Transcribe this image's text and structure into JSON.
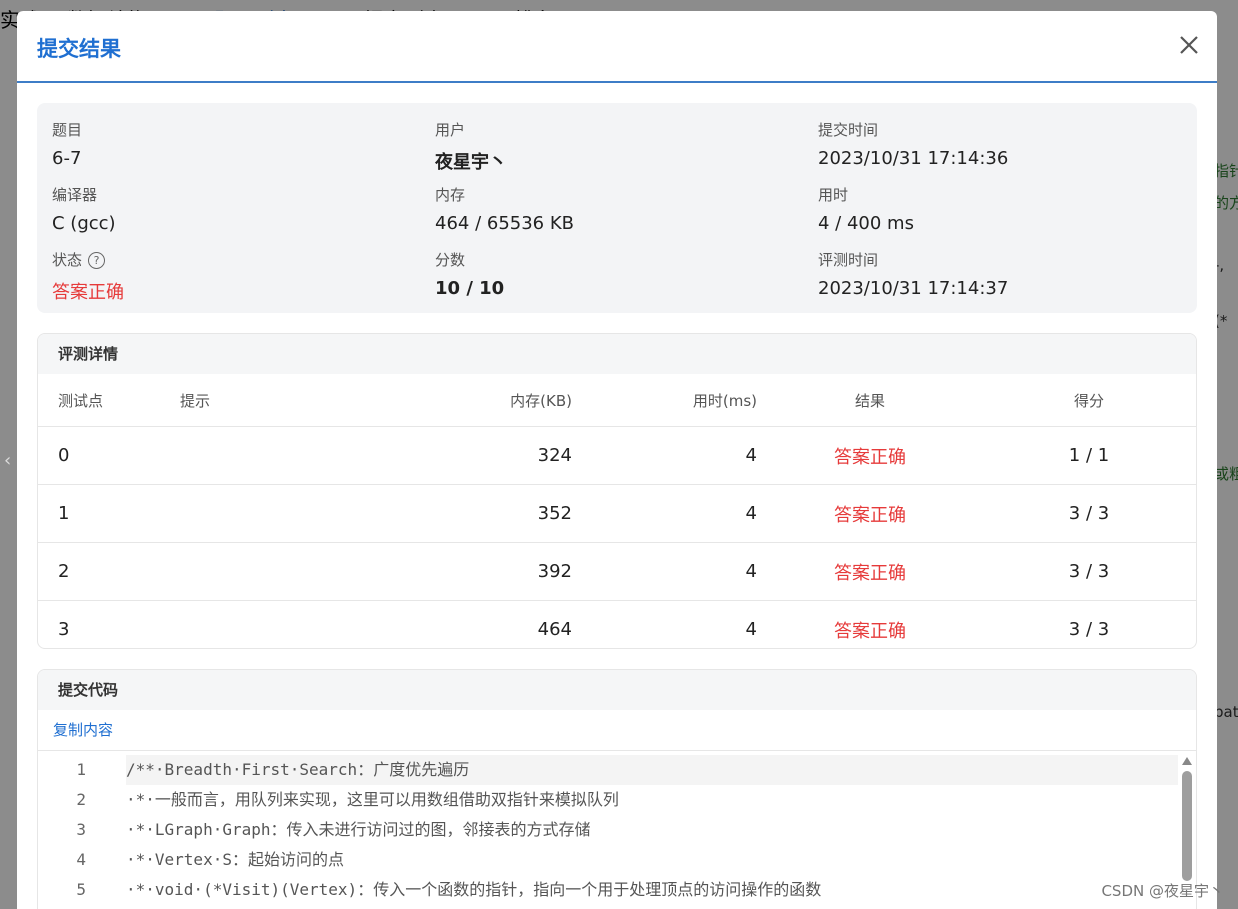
{
  "background": {
    "nav": [
      "实践 7(数据结构)",
      "题目列表",
      "提交列表",
      "排名"
    ],
    "right_snippets": [
      "指针",
      "的方",
      "-,",
      "(*",
      "或粗",
      "pat"
    ]
  },
  "modal": {
    "title": "提交结果",
    "info": {
      "problem_label": "题目",
      "problem": "6-7",
      "user_label": "用户",
      "user": "夜星宇丶",
      "submit_time_label": "提交时间",
      "submit_time": "2023/10/31 17:14:36",
      "compiler_label": "编译器",
      "compiler": "C (gcc)",
      "memory_label": "内存",
      "memory": "464 / 65536 KB",
      "time_label": "用时",
      "time": "4 / 400 ms",
      "status_label": "状态",
      "status": "答案正确",
      "score_label": "分数",
      "score": "10 / 10",
      "judge_time_label": "评测时间",
      "judge_time": "2023/10/31 17:14:37"
    },
    "judge": {
      "title": "评测详情",
      "columns": [
        "测试点",
        "提示",
        "内存(KB)",
        "用时(ms)",
        "结果",
        "得分"
      ],
      "rows": [
        {
          "case": "0",
          "hint": "",
          "memory": "324",
          "time": "4",
          "result": "答案正确",
          "score": "1 / 1"
        },
        {
          "case": "1",
          "hint": "",
          "memory": "352",
          "time": "4",
          "result": "答案正确",
          "score": "3 / 3"
        },
        {
          "case": "2",
          "hint": "",
          "memory": "392",
          "time": "4",
          "result": "答案正确",
          "score": "3 / 3"
        },
        {
          "case": "3",
          "hint": "",
          "memory": "464",
          "time": "4",
          "result": "答案正确",
          "score": "3 / 3"
        }
      ]
    },
    "code": {
      "title": "提交代码",
      "copy_label": "复制内容",
      "lines": [
        {
          "n": "1",
          "text": "/**·Breadth·First·Search：广度优先遍历"
        },
        {
          "n": "2",
          "text": "·*·一般而言，用队列来实现，这里可以用数组借助双指针来模拟队列"
        },
        {
          "n": "3",
          "text": "·*·LGraph·Graph：传入未进行访问过的图，邻接表的方式存储"
        },
        {
          "n": "4",
          "text": "·*·Vertex·S：起始访问的点"
        },
        {
          "n": "5",
          "text": "·*·void·(*Visit)(Vertex)：传入一个函数的指针，指向一个用于处理顶点的访问操作的函数"
        }
      ]
    }
  },
  "watermark": "CSDN @夜星宇丶",
  "colors": {
    "accent": "#1f6fd1",
    "success": "#e63a3a",
    "divider": "#3d7dc7"
  }
}
